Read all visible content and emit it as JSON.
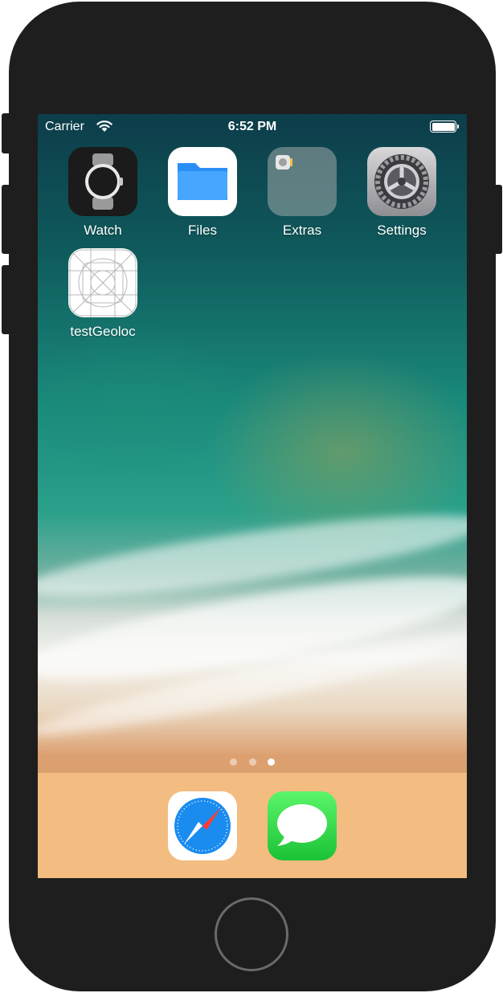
{
  "status_bar": {
    "carrier": "Carrier",
    "time": "6:52 PM",
    "wifi_icon": "wifi-icon",
    "battery_icon": "battery-icon"
  },
  "home_apps": [
    {
      "label": "Watch",
      "icon": "watch-icon"
    },
    {
      "label": "Files",
      "icon": "folder-icon"
    },
    {
      "label": "Extras",
      "icon": "folder-group-icon"
    },
    {
      "label": "Settings",
      "icon": "gear-icon"
    },
    {
      "label": "testGeoloc",
      "icon": "app-template-icon"
    }
  ],
  "page_indicator": {
    "count": 3,
    "active_index": 2
  },
  "dock_apps": [
    {
      "label": "Safari",
      "icon": "compass-icon"
    },
    {
      "label": "Messages",
      "icon": "speech-bubble-icon"
    }
  ],
  "colors": {
    "phone_body": "#1e1e1e",
    "dock_background": "#f5be82",
    "messages_green": "#1bc236",
    "safari_blue": "#1a8cf0",
    "files_blue": "#1e88f0"
  }
}
